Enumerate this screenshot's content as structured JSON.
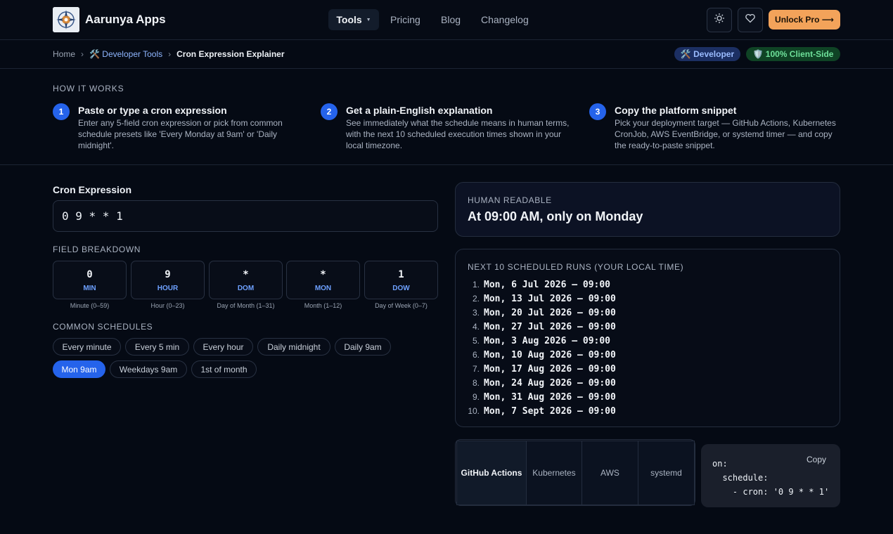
{
  "header": {
    "brand": "Aarunya Apps",
    "nav": {
      "tools": "Tools",
      "pricing": "Pricing",
      "blog": "Blog",
      "changelog": "Changelog"
    },
    "theme_icon": "sun-icon",
    "favorite_icon": "heart-icon",
    "pro_button": "Unlock Pro ⟶"
  },
  "breadcrumb": {
    "home": "Home",
    "category": "🛠️ Developer Tools",
    "current": "Cron Expression Explainer"
  },
  "badges": {
    "developer": "🛠️ Developer",
    "client_side": "🛡️ 100% Client-Side"
  },
  "how_it_works": {
    "title": "HOW IT WORKS",
    "steps": [
      {
        "num": "1",
        "title": "Paste or type a cron expression",
        "desc": "Enter any 5-field cron expression or pick from common schedule presets like 'Every Monday at 9am' or 'Daily midnight'."
      },
      {
        "num": "2",
        "title": "Get a plain-English explanation",
        "desc": "See immediately what the schedule means in human terms, with the next 10 scheduled execution times shown in your local timezone."
      },
      {
        "num": "3",
        "title": "Copy the platform snippet",
        "desc": "Pick your deployment target — GitHub Actions, Kubernetes CronJob, AWS EventBridge, or systemd timer — and copy the ready-to-paste snippet."
      }
    ]
  },
  "cron": {
    "label": "Cron Expression",
    "value": "0 9 * * 1"
  },
  "fields": {
    "title": "FIELD BREAKDOWN",
    "items": [
      {
        "value": "0",
        "name": "MIN",
        "caption": "Minute (0–59)"
      },
      {
        "value": "9",
        "name": "HOUR",
        "caption": "Hour (0–23)"
      },
      {
        "value": "*",
        "name": "DOM",
        "caption": "Day of Month (1–31)"
      },
      {
        "value": "*",
        "name": "MON",
        "caption": "Month (1–12)"
      },
      {
        "value": "1",
        "name": "DOW",
        "caption": "Day of Week (0–7)"
      }
    ]
  },
  "common": {
    "title": "COMMON SCHEDULES",
    "presets": [
      "Every minute",
      "Every 5 min",
      "Every hour",
      "Daily midnight",
      "Daily 9am",
      "Mon 9am",
      "Weekdays 9am",
      "1st of month"
    ],
    "active": "Mon 9am"
  },
  "human": {
    "label": "HUMAN READABLE",
    "text": "At 09:00 AM, only on Monday"
  },
  "runs": {
    "label": "NEXT 10 SCHEDULED RUNS (YOUR LOCAL TIME)",
    "items": [
      {
        "n": "1.",
        "t": "Mon, 6 Jul 2026 — 09:00"
      },
      {
        "n": "2.",
        "t": "Mon, 13 Jul 2026 — 09:00"
      },
      {
        "n": "3.",
        "t": "Mon, 20 Jul 2026 — 09:00"
      },
      {
        "n": "4.",
        "t": "Mon, 27 Jul 2026 — 09:00"
      },
      {
        "n": "5.",
        "t": "Mon, 3 Aug 2026 — 09:00"
      },
      {
        "n": "6.",
        "t": "Mon, 10 Aug 2026 — 09:00"
      },
      {
        "n": "7.",
        "t": "Mon, 17 Aug 2026 — 09:00"
      },
      {
        "n": "8.",
        "t": "Mon, 24 Aug 2026 — 09:00"
      },
      {
        "n": "9.",
        "t": "Mon, 31 Aug 2026 — 09:00"
      },
      {
        "n": "10.",
        "t": "Mon, 7 Sept 2026 — 09:00"
      }
    ]
  },
  "platforms": {
    "tabs": [
      "GitHub Actions",
      "Kubernetes",
      "AWS",
      "systemd"
    ],
    "active": "GitHub Actions",
    "snippet": "on:\n  schedule:\n    - cron: '0 9 * * 1'",
    "copy_label": "Copy"
  },
  "colors": {
    "accent": "#2563eb",
    "pro": "#f3a35a",
    "background": "#050a14"
  }
}
